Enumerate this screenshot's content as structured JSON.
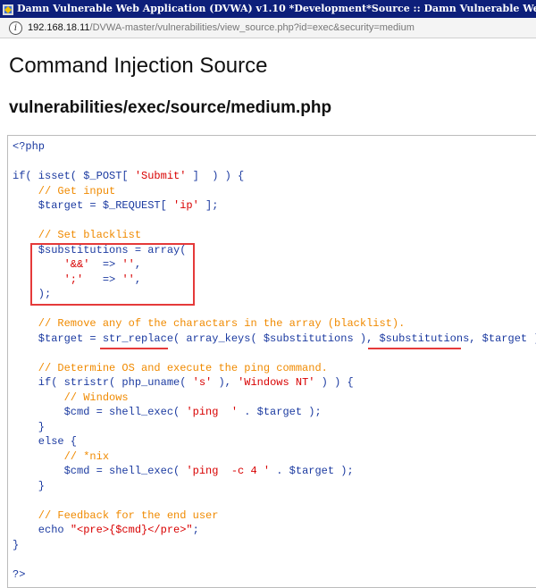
{
  "window": {
    "title": "Damn Vulnerable Web Application (DVWA) v1.10 *Development*Source :: Damn Vulnerable Web Application"
  },
  "address_bar": {
    "host": "192.168.18.11",
    "path": "/DVWA-master/vulnerabilities/view_source.php?id=exec&security=medium"
  },
  "page": {
    "title": "Command Injection Source",
    "subtitle": "vulnerabilities/exec/source/medium.php"
  },
  "code_colors": {
    "default": "#1b3aa0",
    "comment": "#f08a00",
    "string": "#d80000",
    "tag": "#1b3aa0"
  },
  "code": [
    [
      {
        "t": "<?php",
        "c": "default"
      }
    ],
    [],
    [
      {
        "t": "if( isset( $_POST[ ",
        "c": "default"
      },
      {
        "t": "'Submit'",
        "c": "string"
      },
      {
        "t": " ]  ) ) {",
        "c": "default"
      }
    ],
    [
      {
        "t": "    // Get input",
        "c": "comment"
      }
    ],
    [
      {
        "t": "    $target = $_REQUEST[ ",
        "c": "default"
      },
      {
        "t": "'ip'",
        "c": "string"
      },
      {
        "t": " ];",
        "c": "default"
      }
    ],
    [],
    [
      {
        "t": "    // Set blacklist",
        "c": "comment"
      }
    ],
    [
      {
        "t": "    $substitutions = array(",
        "c": "default"
      }
    ],
    [
      {
        "t": "        ",
        "c": "default"
      },
      {
        "t": "'&&'",
        "c": "string"
      },
      {
        "t": "  => ",
        "c": "default"
      },
      {
        "t": "''",
        "c": "string"
      },
      {
        "t": ",",
        "c": "default"
      }
    ],
    [
      {
        "t": "        ",
        "c": "default"
      },
      {
        "t": "';'",
        "c": "string"
      },
      {
        "t": "   => ",
        "c": "default"
      },
      {
        "t": "''",
        "c": "string"
      },
      {
        "t": ",",
        "c": "default"
      }
    ],
    [
      {
        "t": "    );",
        "c": "default"
      }
    ],
    [],
    [
      {
        "t": "    // Remove any of the charactars in the array (blacklist).",
        "c": "comment"
      }
    ],
    [
      {
        "t": "    $target = str_replace( array_keys( $substitutions ), $substitutions, $target );",
        "c": "default"
      }
    ],
    [],
    [
      {
        "t": "    // Determine OS and execute the ping command.",
        "c": "comment"
      }
    ],
    [
      {
        "t": "    if( stristr( php_uname( ",
        "c": "default"
      },
      {
        "t": "'s'",
        "c": "string"
      },
      {
        "t": " ), ",
        "c": "default"
      },
      {
        "t": "'Windows NT'",
        "c": "string"
      },
      {
        "t": " ) ) {",
        "c": "default"
      }
    ],
    [
      {
        "t": "        // Windows",
        "c": "comment"
      }
    ],
    [
      {
        "t": "        $cmd = shell_exec( ",
        "c": "default"
      },
      {
        "t": "'ping  '",
        "c": "string"
      },
      {
        "t": " . $target );",
        "c": "default"
      }
    ],
    [
      {
        "t": "    }",
        "c": "default"
      }
    ],
    [
      {
        "t": "    else {",
        "c": "default"
      }
    ],
    [
      {
        "t": "        // *nix",
        "c": "comment"
      }
    ],
    [
      {
        "t": "        $cmd = shell_exec( ",
        "c": "default"
      },
      {
        "t": "'ping  -c 4 '",
        "c": "string"
      },
      {
        "t": " . $target );",
        "c": "default"
      }
    ],
    [
      {
        "t": "    }",
        "c": "default"
      }
    ],
    [],
    [
      {
        "t": "    // Feedback for the end user",
        "c": "comment"
      }
    ],
    [
      {
        "t": "    echo ",
        "c": "default"
      },
      {
        "t": "\"<pre>{$cmd}</pre>\"",
        "c": "string"
      },
      {
        "t": ";",
        "c": "default"
      }
    ],
    [
      {
        "t": "}",
        "c": "default"
      }
    ],
    [],
    [
      {
        "t": "?>",
        "c": "default"
      }
    ]
  ]
}
